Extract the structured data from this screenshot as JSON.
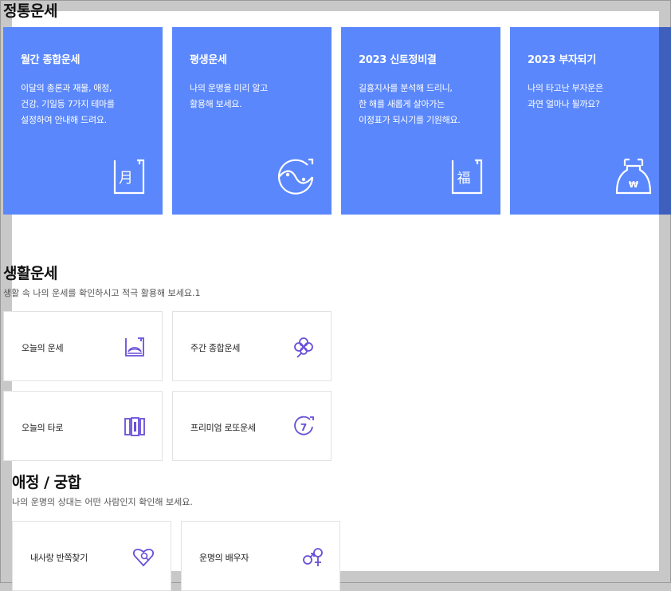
{
  "sections": {
    "fortune_main": {
      "title": "정통운세"
    },
    "life": {
      "title": "생활운세",
      "subtitle": "생활 속 나의 운세를 확인하시고 적극 활용해 보세요.1"
    },
    "love": {
      "title": "애정 / 궁합",
      "subtitle": "나의 운명의 상대는 어떤 사람인지 확인해 보세요."
    }
  },
  "big_cards": [
    {
      "title": "월간 종합운세",
      "desc": [
        "이달의 총론과 재물, 애정,",
        "건강, 기일등 7가지 테마를",
        "설정하여 안내해 드려요."
      ],
      "icon": "moon-character-icon",
      "icon_char": "月"
    },
    {
      "title": "평생운세",
      "desc": [
        "나의 운명을 미리 알고",
        "활용해 보세요."
      ],
      "icon": "yin-yang-icon"
    },
    {
      "title": "2023 신토정비결",
      "desc": [
        "길흉지사를 분석해 드리니,",
        "한 해를 새롭게 살아가는",
        "이정표가 되시기를 기원해요."
      ],
      "icon": "fortune-character-icon",
      "icon_char": "福"
    },
    {
      "title": "2023 부자되기",
      "desc": [
        "나의 타고난 부자운은",
        "과연 얼마나 될까요?"
      ],
      "icon": "money-bag-icon",
      "icon_char": "₩"
    }
  ],
  "life_cards": [
    {
      "label": "오늘의 운세",
      "icon": "sunrise-icon"
    },
    {
      "label": "주간 종합운세",
      "icon": "clover-icon"
    },
    {
      "label": "오늘의 타로",
      "icon": "tarot-cards-icon"
    },
    {
      "label": "프리미엄 로또운세",
      "icon": "lotto-ball-icon",
      "icon_char": "7"
    }
  ],
  "love_cards": [
    {
      "label": "내사랑 반쪽찾기",
      "icon": "heart-search-icon"
    },
    {
      "label": "운명의 배우자",
      "icon": "gender-couple-icon"
    }
  ],
  "colors": {
    "accent": "#5a87fb",
    "icon_purple": "#6a4fd8"
  }
}
